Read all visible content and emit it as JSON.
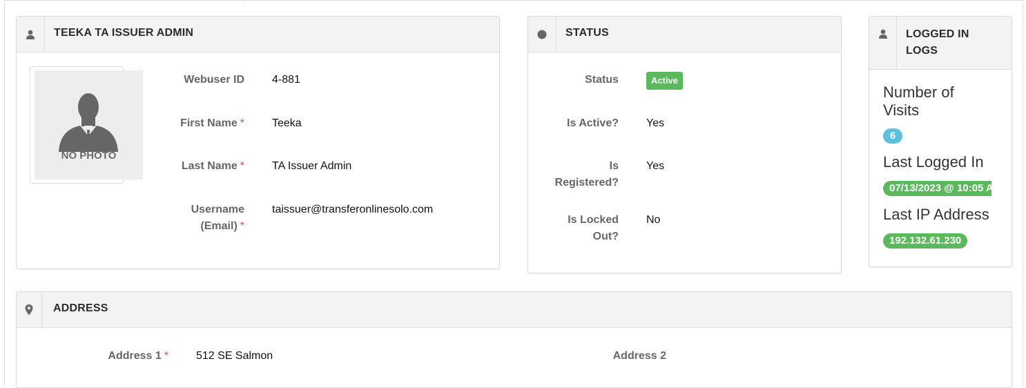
{
  "profile": {
    "title": "TEEKA TA ISSUER ADMIN",
    "no_photo": "NO PHOTO",
    "webuser_id_label": "Webuser ID",
    "webuser_id": "4-881",
    "first_name_label": "First Name",
    "first_name": "Teeka",
    "last_name_label": "Last Name",
    "last_name": "TA Issuer Admin",
    "username_label_1": "Username",
    "username_label_2": "(Email)",
    "username": "taissuer@transferonlinesolo.com",
    "required_mark": "*"
  },
  "status": {
    "title": "STATUS",
    "status_label": "Status",
    "status_value": "Active",
    "is_active_label": "Is Active?",
    "is_active": "Yes",
    "is_registered_label_1": "Is",
    "is_registered_label_2": "Registered?",
    "is_registered": "Yes",
    "is_locked_label_1": "Is Locked",
    "is_locked_label_2": "Out?",
    "is_locked": "No"
  },
  "logs": {
    "title_1": "LOGGED IN",
    "title_2": "LOGS",
    "visits_label_1": "Number of",
    "visits_label_2": "Visits",
    "visits": "6",
    "last_logged_label": "Last Logged In",
    "last_logged": "07/13/2023 @ 10:05 A",
    "last_ip_label": "Last IP Address",
    "last_ip": "192.132.61.230"
  },
  "address": {
    "title": "ADDRESS",
    "address1_label": "Address 1",
    "address1": "512 SE Salmon",
    "address2_label": "Address 2",
    "required_mark": "*"
  },
  "colors": {
    "success": "#5cb85c",
    "info": "#5bc0de",
    "required": "#d9534f"
  },
  "icons": [
    "user-icon",
    "circle-icon",
    "user-icon",
    "map-marker-icon",
    "person-silhouette-icon"
  ]
}
